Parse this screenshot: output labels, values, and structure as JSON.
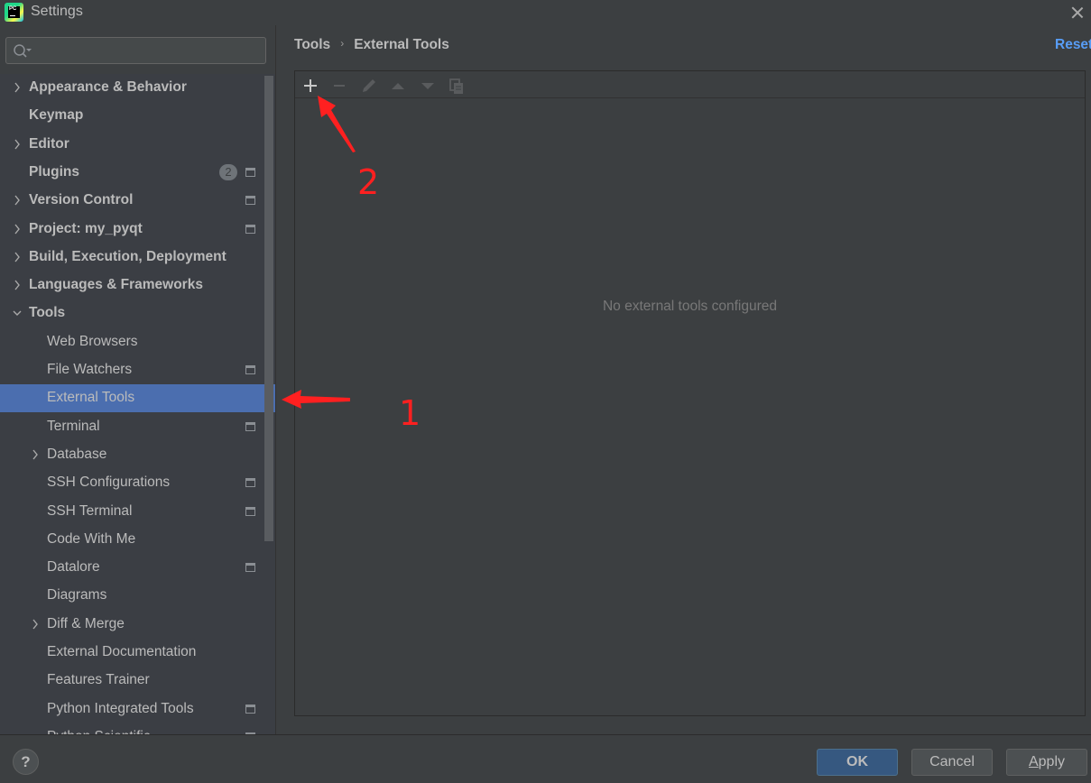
{
  "window": {
    "title": "Settings",
    "app_icon_text": "PC"
  },
  "search": {
    "placeholder": "",
    "value": ""
  },
  "tree": [
    {
      "label": "Appearance & Behavior",
      "level": 0,
      "expandable": true,
      "expanded": false,
      "project_icon": false
    },
    {
      "label": "Keymap",
      "level": 0,
      "expandable": false,
      "project_icon": false
    },
    {
      "label": "Editor",
      "level": 0,
      "expandable": true,
      "expanded": false,
      "project_icon": false
    },
    {
      "label": "Plugins",
      "level": 0,
      "expandable": false,
      "badge": "2",
      "project_icon": true
    },
    {
      "label": "Version Control",
      "level": 0,
      "expandable": true,
      "expanded": false,
      "project_icon": true
    },
    {
      "label": "Project: my_pyqt",
      "level": 0,
      "expandable": true,
      "expanded": false,
      "project_icon": true
    },
    {
      "label": "Build, Execution, Deployment",
      "level": 0,
      "expandable": true,
      "expanded": false,
      "project_icon": false
    },
    {
      "label": "Languages & Frameworks",
      "level": 0,
      "expandable": true,
      "expanded": false,
      "project_icon": false
    },
    {
      "label": "Tools",
      "level": 0,
      "expandable": true,
      "expanded": true,
      "project_icon": false
    },
    {
      "label": "Web Browsers",
      "level": 1,
      "expandable": false,
      "project_icon": false
    },
    {
      "label": "File Watchers",
      "level": 1,
      "expandable": false,
      "project_icon": true
    },
    {
      "label": "External Tools",
      "level": 1,
      "expandable": false,
      "project_icon": false,
      "selected": true
    },
    {
      "label": "Terminal",
      "level": 1,
      "expandable": false,
      "project_icon": true
    },
    {
      "label": "Database",
      "level": 1,
      "expandable": true,
      "expanded": false,
      "project_icon": false
    },
    {
      "label": "SSH Configurations",
      "level": 1,
      "expandable": false,
      "project_icon": true
    },
    {
      "label": "SSH Terminal",
      "level": 1,
      "expandable": false,
      "project_icon": true
    },
    {
      "label": "Code With Me",
      "level": 1,
      "expandable": false,
      "project_icon": false
    },
    {
      "label": "Datalore",
      "level": 1,
      "expandable": false,
      "project_icon": true
    },
    {
      "label": "Diagrams",
      "level": 1,
      "expandable": false,
      "project_icon": false
    },
    {
      "label": "Diff & Merge",
      "level": 1,
      "expandable": true,
      "expanded": false,
      "project_icon": false
    },
    {
      "label": "External Documentation",
      "level": 1,
      "expandable": false,
      "project_icon": false
    },
    {
      "label": "Features Trainer",
      "level": 1,
      "expandable": false,
      "project_icon": false
    },
    {
      "label": "Python Integrated Tools",
      "level": 1,
      "expandable": false,
      "project_icon": true
    },
    {
      "label": "Python Scientific",
      "level": 1,
      "expandable": false,
      "project_icon": true
    }
  ],
  "content": {
    "breadcrumb": [
      "Tools",
      "External Tools"
    ],
    "breadcrumb_separator": "›",
    "reset_label": "Reset",
    "empty_text": "No external tools configured",
    "toolbar": [
      {
        "name": "add",
        "icon": "plus-icon",
        "enabled": true
      },
      {
        "name": "remove",
        "icon": "minus-icon",
        "enabled": false
      },
      {
        "name": "edit",
        "icon": "pencil-icon",
        "enabled": false
      },
      {
        "name": "move-up",
        "icon": "triangle-up-icon",
        "enabled": false
      },
      {
        "name": "move-down",
        "icon": "triangle-down-icon",
        "enabled": false
      },
      {
        "name": "copy",
        "icon": "copy-icon",
        "enabled": false
      }
    ]
  },
  "annotations": {
    "step1": "1",
    "step2": "2",
    "color": "#ff2020"
  },
  "footer": {
    "help_label": "?",
    "ok_label": "OK",
    "cancel_label": "Cancel",
    "apply_label_mnemonic": "A",
    "apply_label_rest": "pply"
  },
  "colors": {
    "accent_link": "#589df6",
    "selection": "#4b6eaf",
    "ok_button": "#365880",
    "background": "#3c3f41"
  }
}
